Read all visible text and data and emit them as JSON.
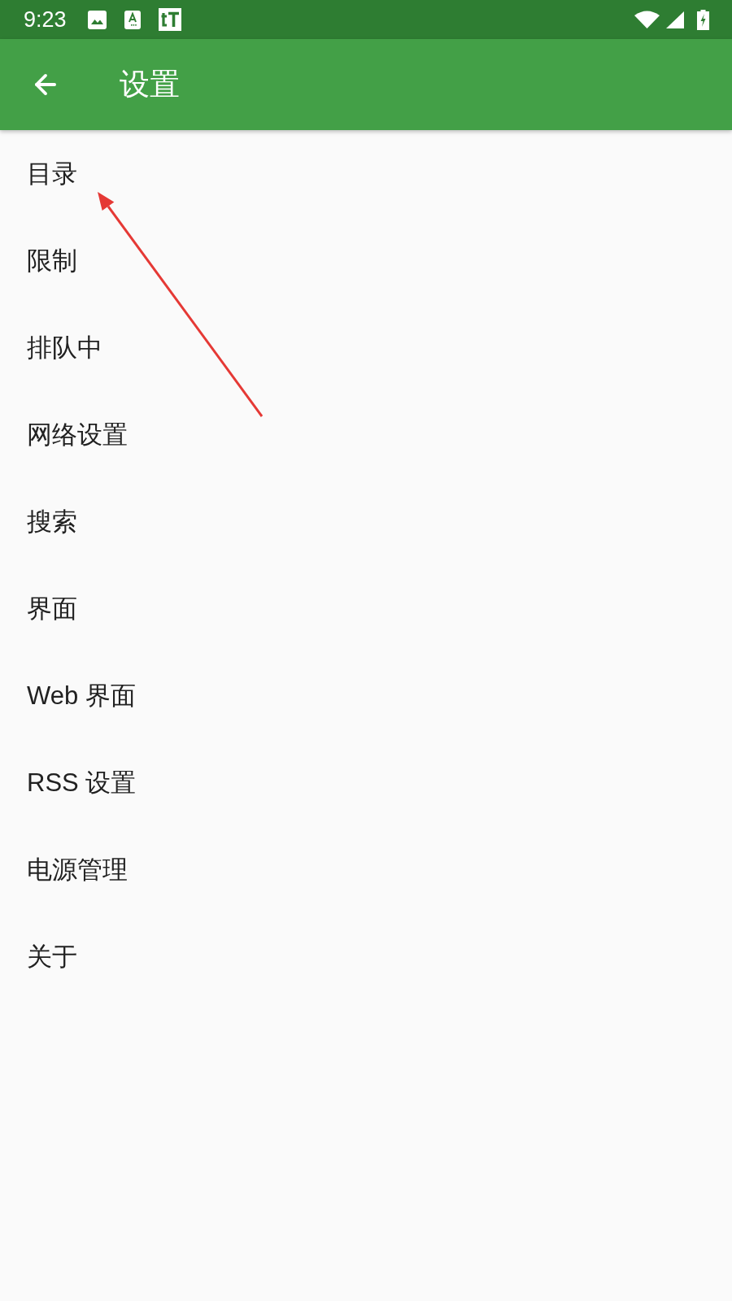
{
  "status_bar": {
    "time": "9:23"
  },
  "app_bar": {
    "title": "设置"
  },
  "settings": [
    "目录",
    "限制",
    "排队中",
    "网络设置",
    "搜索",
    "界面",
    "Web 界面",
    "RSS 设置",
    "电源管理",
    "关于"
  ],
  "annotation": {
    "kind": "arrow"
  }
}
